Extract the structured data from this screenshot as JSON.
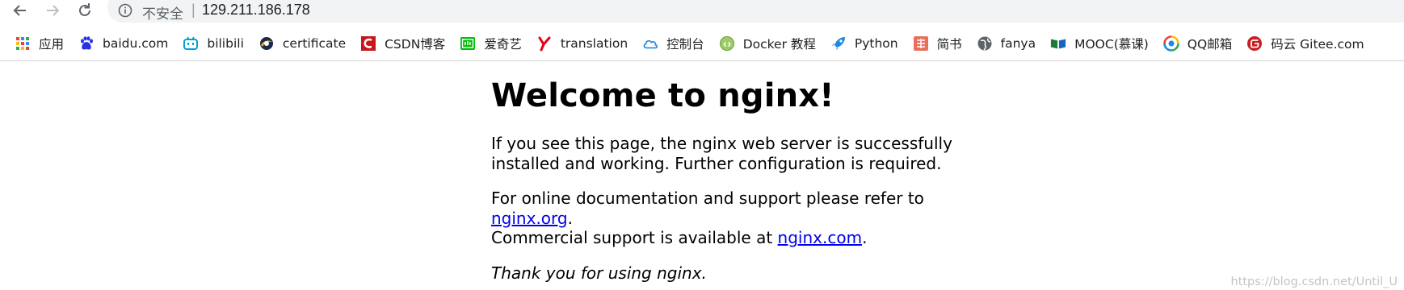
{
  "address_bar": {
    "security_label": "不安全",
    "separator": "|",
    "url": "129.211.186.178"
  },
  "bookmarks": [
    {
      "name": "apps",
      "label": "应用",
      "icon": "apps-grid-icon"
    },
    {
      "name": "baidu",
      "label": "baidu.com",
      "icon": "baidu-paw-icon"
    },
    {
      "name": "bilibili",
      "label": "bilibili",
      "icon": "bilibili-tv-icon"
    },
    {
      "name": "certificate",
      "label": "certificate",
      "icon": "certificate-swirl-icon"
    },
    {
      "name": "csdn",
      "label": "CSDN博客",
      "icon": "csdn-c-icon"
    },
    {
      "name": "iqiyi",
      "label": "爱奇艺",
      "icon": "iqiyi-icon"
    },
    {
      "name": "translation",
      "label": "translation",
      "icon": "youdao-y-icon"
    },
    {
      "name": "console",
      "label": "控制台",
      "icon": "cloud-icon"
    },
    {
      "name": "docker",
      "label": "Docker 教程",
      "icon": "docker-icon"
    },
    {
      "name": "python",
      "label": "Python",
      "icon": "rocket-icon"
    },
    {
      "name": "jianshu",
      "label": "简书",
      "icon": "jianshu-icon"
    },
    {
      "name": "fanya",
      "label": "fanya",
      "icon": "globe-icon"
    },
    {
      "name": "mooc",
      "label": "MOOC(慕课)",
      "icon": "mooc-book-icon"
    },
    {
      "name": "qqmail",
      "label": "QQ邮箱",
      "icon": "qqmail-icon"
    },
    {
      "name": "gitee",
      "label": "码云 Gitee.com",
      "icon": "gitee-icon"
    }
  ],
  "page": {
    "heading": "Welcome to nginx!",
    "para1": "If you see this page, the nginx web server is successfully installed and working. Further configuration is required.",
    "para2_prefix": "For online documentation and support please refer to ",
    "link_org": "nginx.org",
    "para2_mid": ".",
    "para2_line2": "Commercial support is available at ",
    "link_com": "nginx.com",
    "para2_end": ".",
    "thanks": "Thank you for using nginx."
  },
  "watermark": "https://blog.csdn.net/Until_U"
}
